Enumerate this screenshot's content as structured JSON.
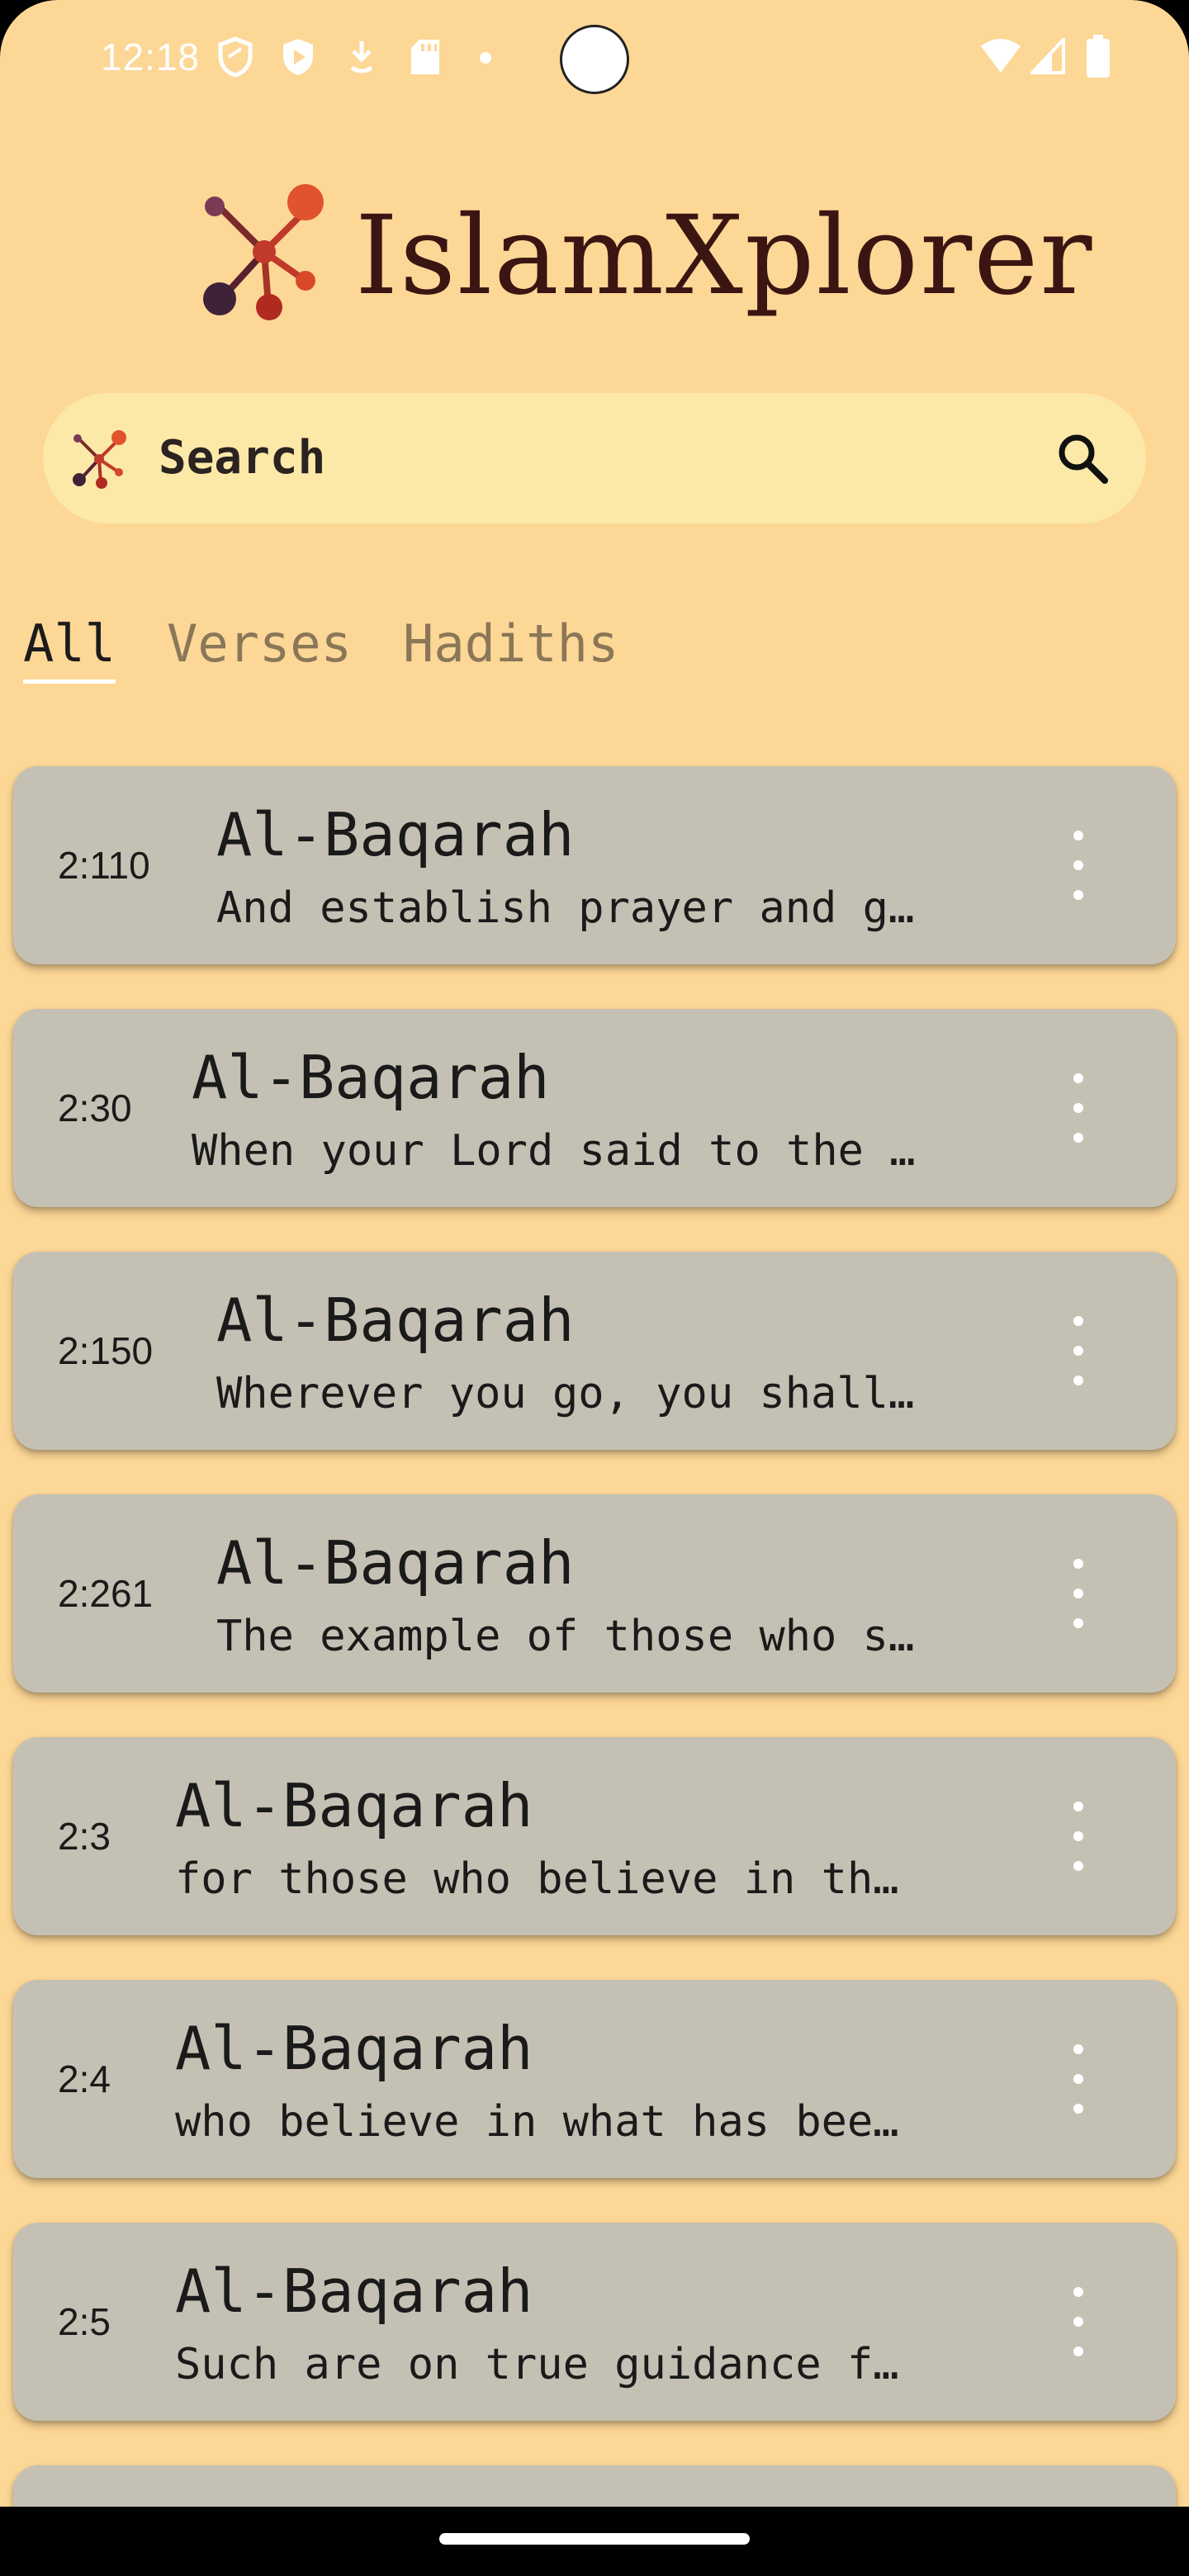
{
  "status_bar": {
    "time": "12:18",
    "left_icons": [
      "shield-outline-icon",
      "shield-icon",
      "play-icon",
      "download-arrow-icon",
      "sd-card-icon",
      "dot-icon"
    ],
    "right_icons": [
      "wifi-icon",
      "signal-icon",
      "battery-icon"
    ]
  },
  "app": {
    "name": "IslamXplorer",
    "logo_colors": [
      "#d8492a",
      "#b02a20",
      "#6a2a3a",
      "#3a1512"
    ]
  },
  "search": {
    "label": "Search"
  },
  "tabs": [
    {
      "label": "All",
      "active": true
    },
    {
      "label": "Verses",
      "active": false
    },
    {
      "label": "Hadiths",
      "active": false
    }
  ],
  "results": [
    {
      "ref": "2:110",
      "title": "Al-Baqarah",
      "text": "And establish prayer and g…"
    },
    {
      "ref": "2:30",
      "title": "Al-Baqarah",
      "text": "When your Lord said to the …"
    },
    {
      "ref": "2:150",
      "title": "Al-Baqarah",
      "text": "Wherever you go, you shall…"
    },
    {
      "ref": "2:261",
      "title": "Al-Baqarah",
      "text": "The example of those who s…"
    },
    {
      "ref": "2:3",
      "title": "Al-Baqarah",
      "text": "for those who believe in th…"
    },
    {
      "ref": "2:4",
      "title": "Al-Baqarah",
      "text": "who believe in what has bee…"
    },
    {
      "ref": "2:5",
      "title": "Al-Baqarah",
      "text": "Such are on true guidance f…"
    }
  ],
  "colors": {
    "background": "#fdd796",
    "search_bg": "#fce9a8",
    "card_bg": "#c4c1b4",
    "tab_inactive": "#8a7758"
  }
}
